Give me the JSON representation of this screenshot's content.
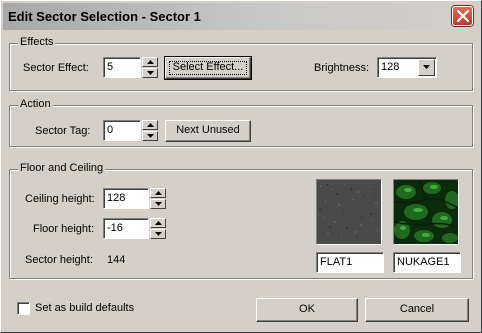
{
  "window": {
    "title": "Edit Sector Selection - Sector 1"
  },
  "effects": {
    "group_label": "Effects",
    "sector_effect_label": "Sector Effect:",
    "sector_effect_value": "5",
    "select_effect_label": "Select Effect...",
    "brightness_label": "Brightness:",
    "brightness_value": "128"
  },
  "action": {
    "group_label": "Action",
    "sector_tag_label": "Sector Tag:",
    "sector_tag_value": "0",
    "next_unused_label": "Next Unused"
  },
  "floor_ceiling": {
    "group_label": "Floor and Ceiling",
    "ceiling_height_label": "Ceiling height:",
    "ceiling_height_value": "128",
    "floor_height_label": "Floor height:",
    "floor_height_value": "-16",
    "sector_height_label": "Sector height:",
    "sector_height_value": "144",
    "ceiling_texture": "FLAT1",
    "floor_texture": "NUKAGE1"
  },
  "footer": {
    "build_defaults_label": "Set as build defaults",
    "build_defaults_checked": false,
    "ok_label": "OK",
    "cancel_label": "Cancel"
  },
  "icons": {
    "close": "close-icon",
    "spin_up": "arrow-up-icon",
    "spin_down": "arrow-down-icon",
    "dropdown": "chevron-down-icon"
  },
  "colors": {
    "dialog_bg": "#d4d0c8",
    "close_button": "#c0392b",
    "flat1_texture": "#4a4a4a",
    "nukage1_texture": "#1f6a1f"
  }
}
